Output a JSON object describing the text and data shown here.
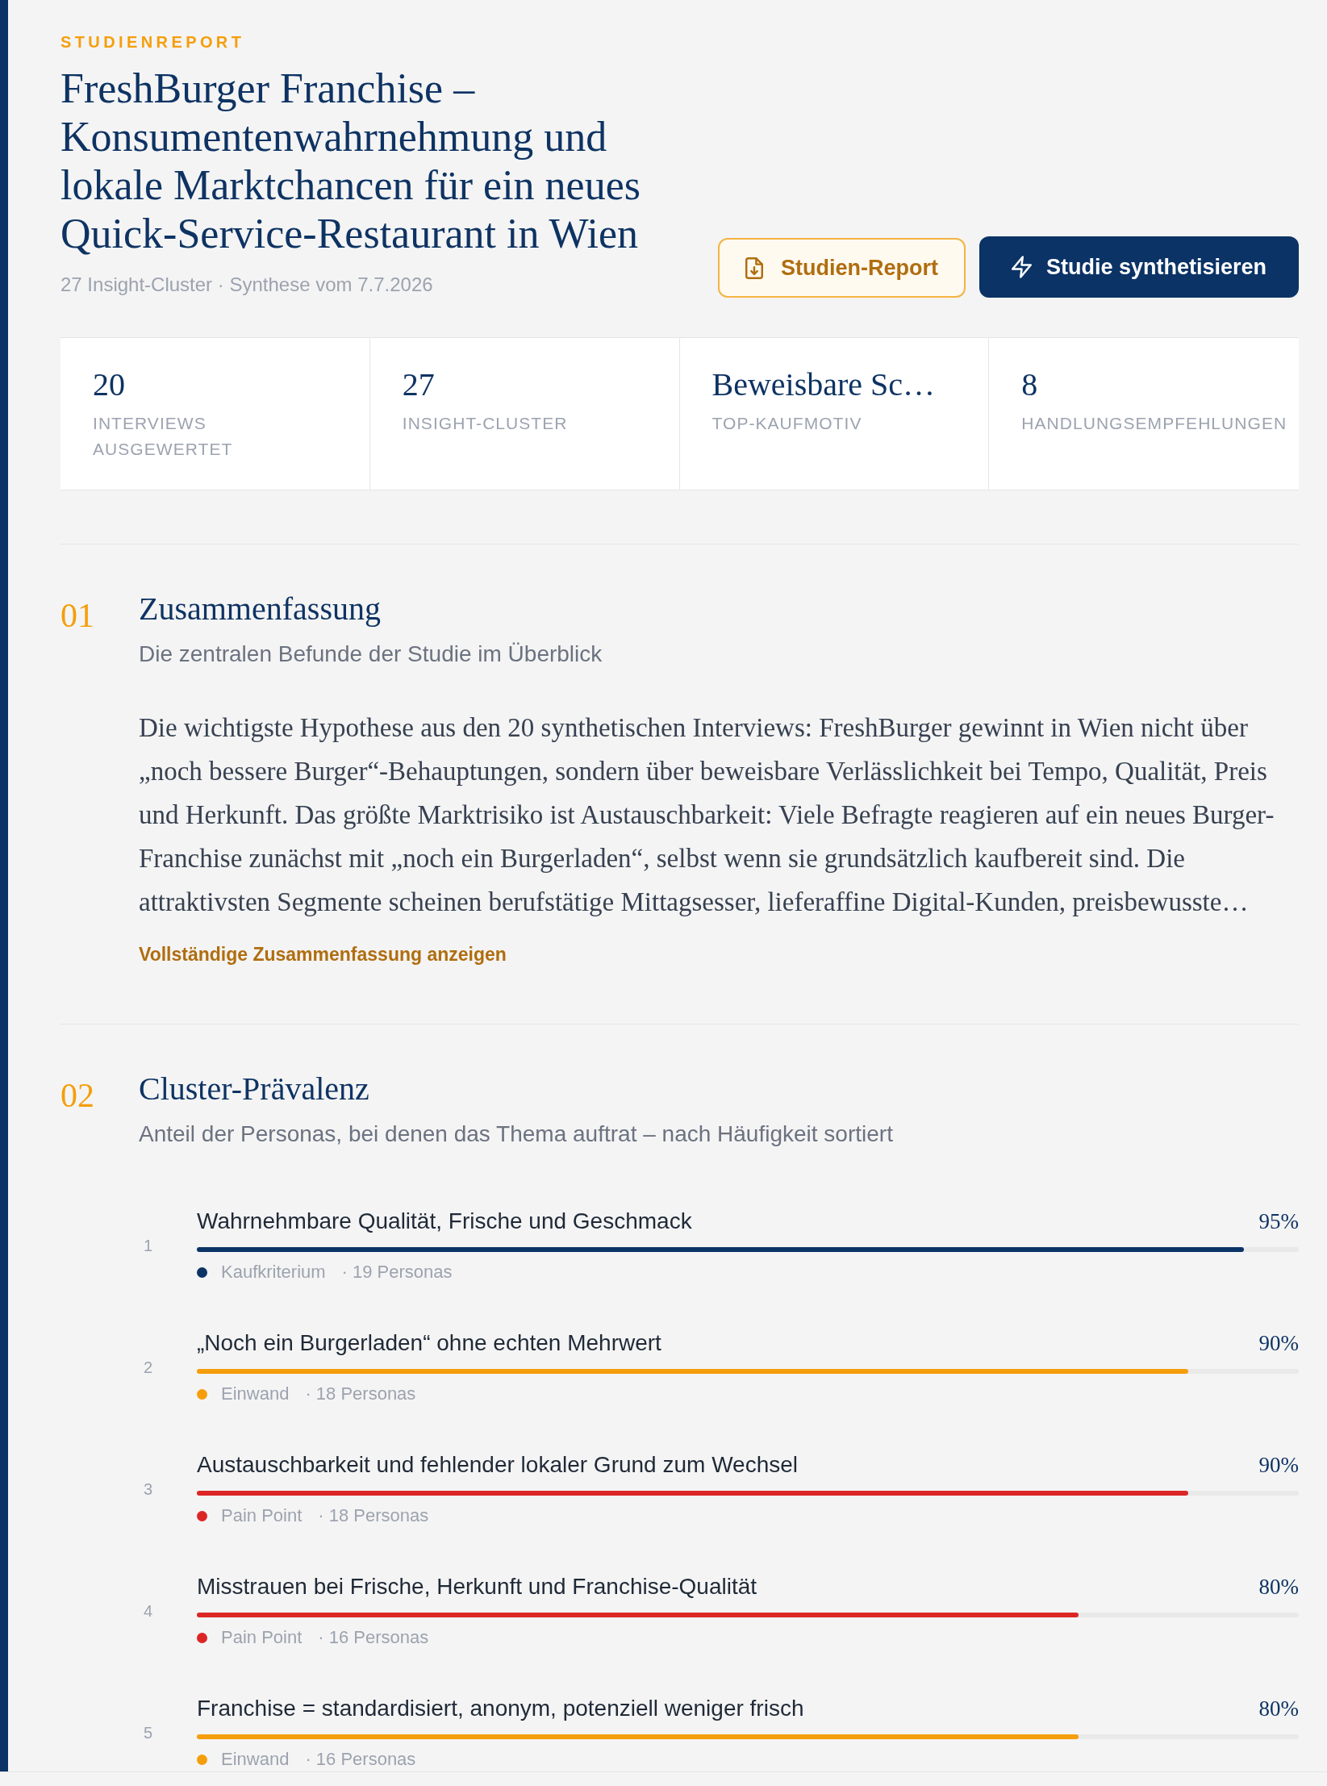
{
  "header": {
    "eyebrow": "STUDIENREPORT",
    "title": "FreshBurger Franchise – Konsumentenwahrnehmung und lokale Marktchancen für ein neues Quick-Service-Restaurant in Wien",
    "meta": "27 Insight-Cluster · Synthese vom 7.7.2026",
    "buttons": [
      {
        "label": "Studien-Report",
        "kind": "outline"
      },
      {
        "label": "Studie synthetisieren",
        "kind": "primary"
      }
    ]
  },
  "stats": [
    {
      "value": "20",
      "label": "INTERVIEWS AUSGEWERTET"
    },
    {
      "value": "27",
      "label": "INSIGHT-CLUSTER"
    },
    {
      "value": "Beweisbare Sc…",
      "label": "TOP-KAUFMOTIV"
    },
    {
      "value": "8",
      "label": "HANDLUNGSEMPFEHLUNGEN"
    }
  ],
  "sections": [
    {
      "kind": "summary",
      "number": "01",
      "title": "Zusammenfassung",
      "subtitle": "Die zentralen Befunde der Studie im Überblick",
      "body": "Die wichtigste Hypothese aus den 20 synthetischen Interviews: FreshBurger gewinnt in Wien nicht über „noch bessere Burger“-Behauptungen, sondern über beweisbare Verlässlichkeit bei Tempo, Qualität, Preis und Herkunft. Das größte Marktrisiko ist Austauschbarkeit: Viele Befragte reagieren auf ein neues Burger-Franchise zunächst mit „noch ein Burgerladen“, selbst wenn sie grundsätzlich kaufbereit sind. Die attraktivsten Segmente scheinen berufstätige Mittagsesser, lieferaffine Digital-Kunden, preisbewusste…",
      "link": "Vollständige Zusammenfassung anzeigen"
    },
    {
      "kind": "clusters",
      "number": "02",
      "title": "Cluster-Prävalenz",
      "subtitle": "Anteil der Personas, bei denen das Thema auftrat – nach Häufigkeit sortiert",
      "clusters": [
        {
          "rank": "1",
          "title": "Wahrnehmbare Qualität, Frische und Geschmack",
          "percent": "95%",
          "level": 0.95,
          "category": "Kaufkriterium",
          "color": "#0b3366",
          "count": "· 19 Personas"
        },
        {
          "rank": "2",
          "title": "„Noch ein Burgerladen“ ohne echten Mehrwert",
          "percent": "90%",
          "level": 0.9,
          "category": "Einwand",
          "color": "#f59e0b",
          "count": "· 18 Personas"
        },
        {
          "rank": "3",
          "title": "Austauschbarkeit und fehlender lokaler Grund zum Wechsel",
          "percent": "90%",
          "level": 0.9,
          "category": "Pain Point",
          "color": "#dc2626",
          "count": "· 18 Personas"
        },
        {
          "rank": "4",
          "title": "Misstrauen bei Frische, Herkunft und Franchise-Qualität",
          "percent": "80%",
          "level": 0.8,
          "category": "Pain Point",
          "color": "#dc2626",
          "count": "· 16 Personas"
        },
        {
          "rank": "5",
          "title": "Franchise = standardisiert, anonym, potenziell weniger frisch",
          "percent": "80%",
          "level": 0.8,
          "category": "Einwand",
          "color": "#f59e0b",
          "count": "· 16 Personas"
        }
      ]
    }
  ]
}
